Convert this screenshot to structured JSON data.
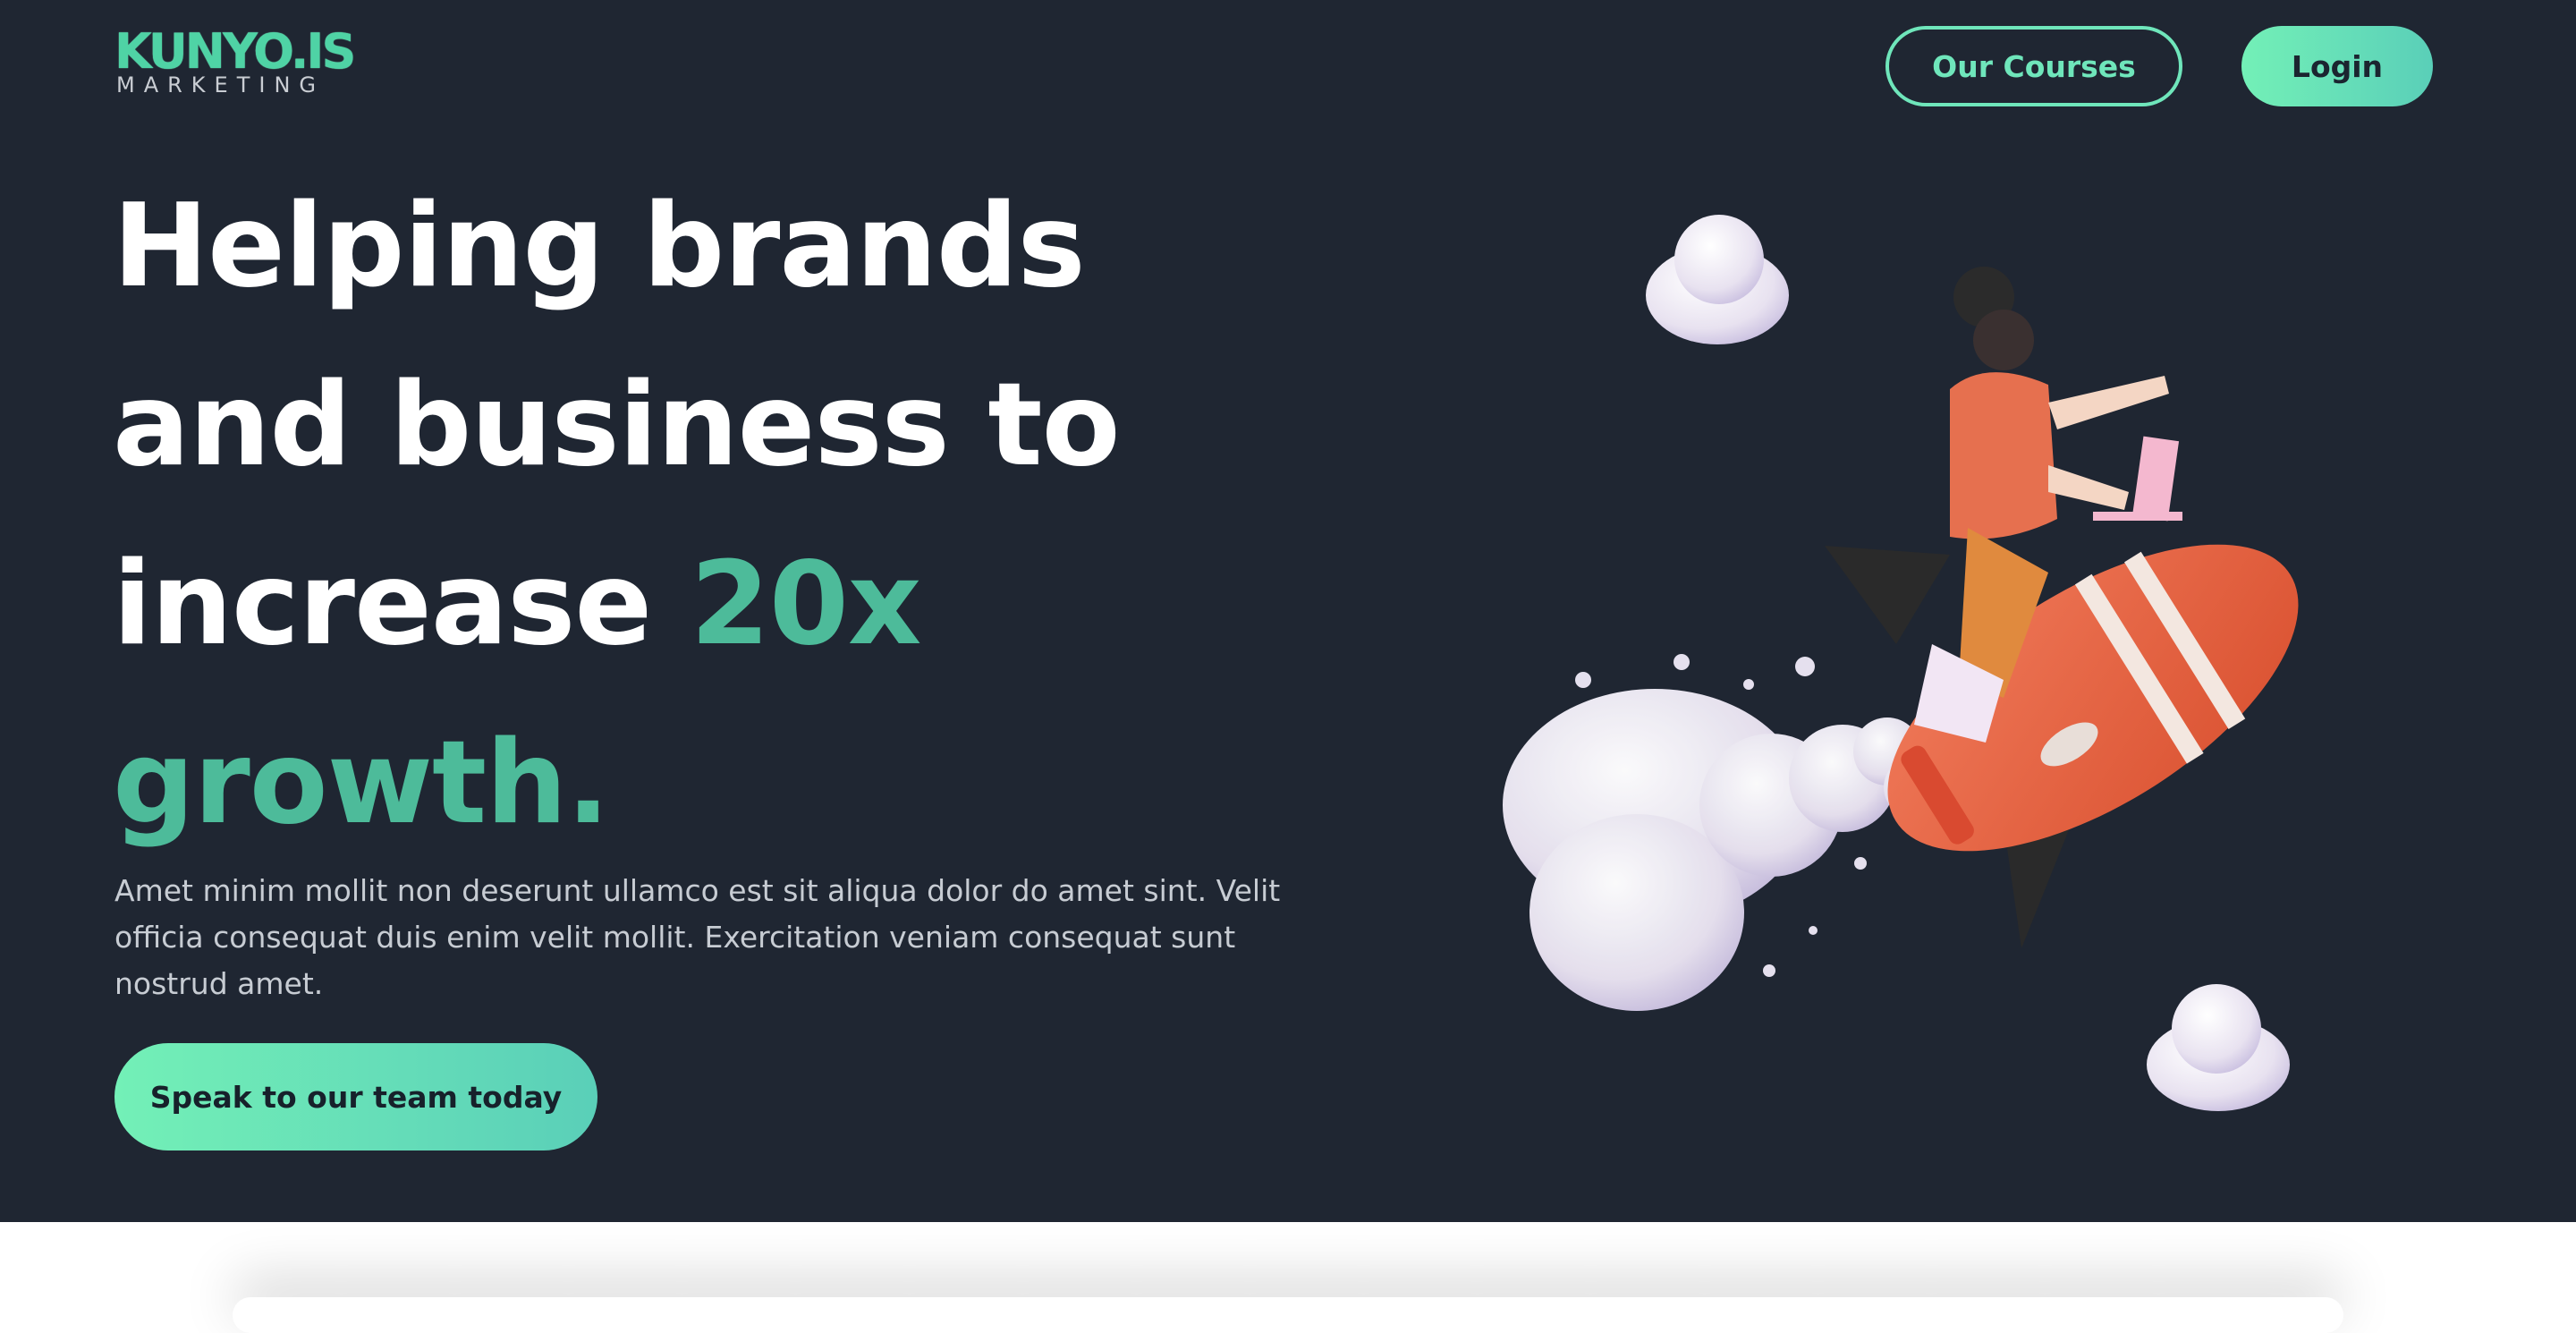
{
  "logo": {
    "main": "KUNYO.IS",
    "sub": "MARKETING"
  },
  "nav": {
    "courses_label": "Our Courses",
    "login_label": "Login"
  },
  "hero": {
    "headline_line1": "Helping brands",
    "headline_line2": "and business to",
    "headline_line3_start": "increase ",
    "headline_accent1": "20x",
    "headline_accent2": "growth.",
    "paragraph": "Amet minim mollit non deserunt ullamco est sit aliqua dolor do amet sint. Velit officia consequat duis enim velit mollit. Exercitation veniam consequat sunt nostrud amet.",
    "cta_label": "Speak to our team today"
  },
  "colors": {
    "background": "#1f2632",
    "accent": "#4dbb9a",
    "button_gradient_start": "#73f0b7",
    "button_gradient_end": "#5acfb8"
  },
  "icons": {
    "illustration": "rocket-rider-illustration",
    "cloud": "cloud-icon"
  }
}
